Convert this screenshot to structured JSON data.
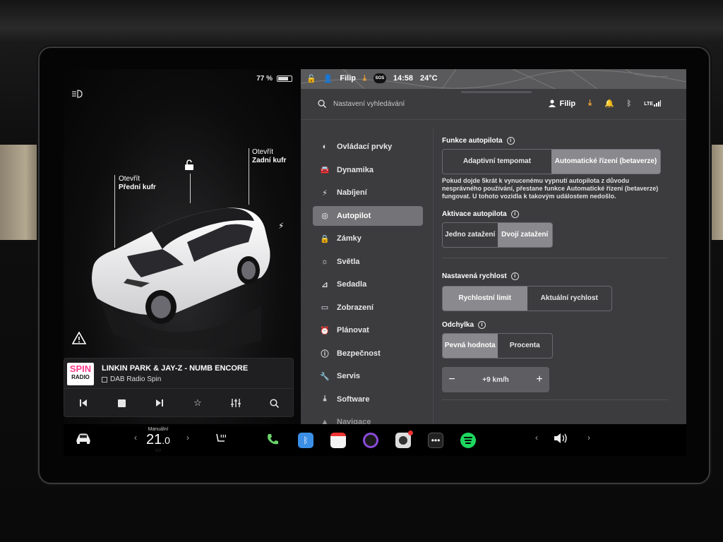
{
  "battery": {
    "percent_label": "77 %",
    "level": 0.77
  },
  "car_view": {
    "frunk_label": "Otevřít",
    "frunk_sub": "Přední kufr",
    "trunk_label": "Otevřít",
    "trunk_sub": "Zadní kufr"
  },
  "media": {
    "logo_top": "SPIN",
    "logo_bottom": "RADIO",
    "track": "LINKIN PARK & JAY-Z - NUMB ENCORE",
    "station": "DAB Radio Spin",
    "controls": [
      "prev-icon",
      "stop-icon",
      "next-icon",
      "star-icon",
      "equalizer-icon",
      "search-icon"
    ]
  },
  "status_bar": {
    "user": "Filip",
    "sos": "SOS",
    "time": "14:58",
    "temperature": "24°C"
  },
  "header": {
    "search_placeholder": "Nastavení vyhledávání",
    "user": "Filip",
    "lte": "LTE"
  },
  "nav": {
    "items": [
      {
        "label": "Ovládací prvky",
        "icon": "toggle-icon"
      },
      {
        "label": "Dynamika",
        "icon": "car-icon"
      },
      {
        "label": "Nabíjení",
        "icon": "bolt-icon"
      },
      {
        "label": "Autopilot",
        "icon": "steering-wheel-icon",
        "active": true
      },
      {
        "label": "Zámky",
        "icon": "lock-icon"
      },
      {
        "label": "Světla",
        "icon": "sun-icon"
      },
      {
        "label": "Sedadla",
        "icon": "seat-icon"
      },
      {
        "label": "Zobrazení",
        "icon": "display-icon"
      },
      {
        "label": "Plánovat",
        "icon": "clock-icon"
      },
      {
        "label": "Bezpečnost",
        "icon": "shield-icon"
      },
      {
        "label": "Servis",
        "icon": "wrench-icon"
      },
      {
        "label": "Software",
        "icon": "download-icon"
      },
      {
        "label": "Navigace",
        "icon": "navigation-icon"
      }
    ]
  },
  "autopilot": {
    "features_title": "Funkce autopilota",
    "features_options": [
      "Adaptivní tempomat",
      "Automatické řízení (betaverze)"
    ],
    "features_selected": 1,
    "warning": "Pokud dojde 5krát k vynucenému vypnutí autopilota z důvodu nesprávného používání, přestane funkce Automatické řízení (betaverze) fungovat. U tohoto vozidla k takovým událostem nedošlo.",
    "activation_title": "Aktivace autopilota",
    "activation_options": [
      "Jedno zatažení",
      "Dvojí zatažení"
    ],
    "activation_selected": 1,
    "speed_title": "Nastavená rychlost",
    "speed_options": [
      "Rychlostní limit",
      "Aktuální rychlost"
    ],
    "speed_selected": 0,
    "offset_title": "Odchylka",
    "offset_options": [
      "Pevná hodnota",
      "Procenta"
    ],
    "offset_selected": 0,
    "offset_value": "+9 km/h",
    "minus": "−",
    "plus": "+"
  },
  "dock": {
    "climate_mode": "Manuální",
    "temp_int": "21",
    "temp_dec": ".0",
    "left_arrow": "‹",
    "right_arrow": "›"
  },
  "colors": {
    "accent_download": "#f3a631",
    "spin_pink": "#ff3c8d",
    "nav_active": "#747478"
  }
}
